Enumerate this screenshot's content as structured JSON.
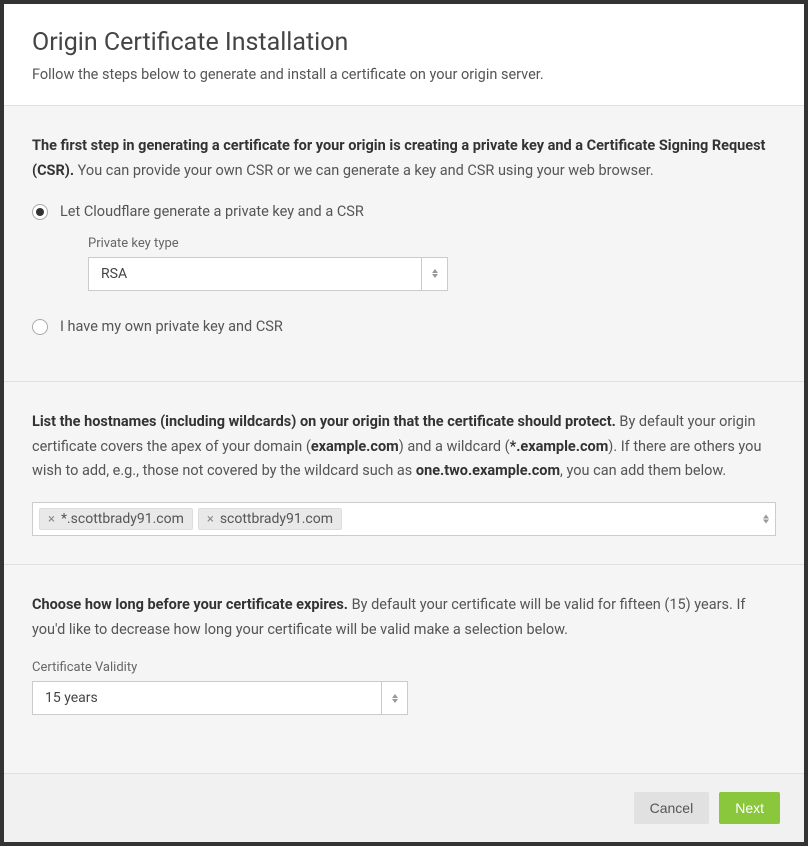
{
  "header": {
    "title": "Origin Certificate Installation",
    "subtitle": "Follow the steps below to generate and install a certificate on your origin server."
  },
  "step1": {
    "intro_bold": "The first step in generating a certificate for your origin is creating a private key and a Certificate Signing Request (CSR).",
    "intro_rest": " You can provide your own CSR or we can generate a key and CSR using your web browser.",
    "option_generate": "Let Cloudflare generate a private key and a CSR",
    "option_own": "I have my own private key and CSR",
    "private_key_label": "Private key type",
    "private_key_value": "RSA"
  },
  "step2": {
    "intro_bold": "List the hostnames (including wildcards) on your origin that the certificate should protect.",
    "intro_rest_1": " By default your origin certificate covers the apex of your domain (",
    "example1": "example.com",
    "intro_rest_2": ") and a wildcard (",
    "example2": "*.example.com",
    "intro_rest_3": "). If there are others you wish to add, e.g., those not covered by the wildcard such as ",
    "example3": "one.two.example.com",
    "intro_rest_4": ", you can add them below.",
    "hostnames": [
      "*.scottbrady91.com",
      "scottbrady91.com"
    ]
  },
  "step3": {
    "intro_bold": "Choose how long before your certificate expires.",
    "intro_rest": " By default your certificate will be valid for fifteen (15) years. If you'd like to decrease how long your certificate will be valid make a selection below.",
    "validity_label": "Certificate Validity",
    "validity_value": "15 years"
  },
  "footer": {
    "cancel": "Cancel",
    "next": "Next"
  }
}
